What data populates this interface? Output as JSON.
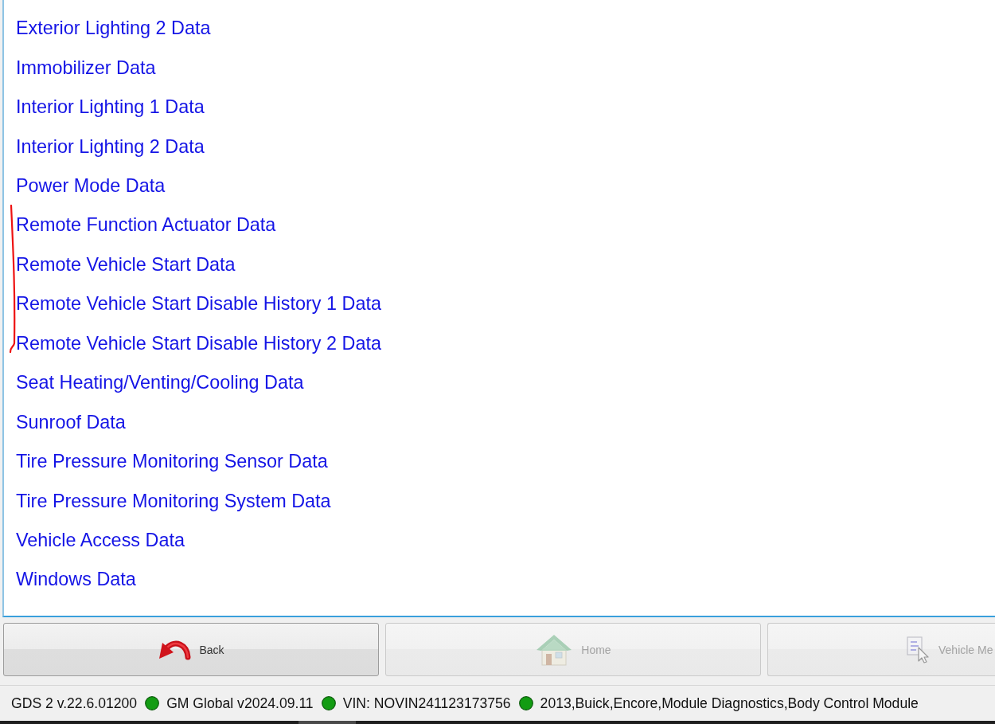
{
  "data_list": {
    "items": [
      {
        "label": "Exterior Lighting 2 Data",
        "marked": false
      },
      {
        "label": "Immobilizer Data",
        "marked": false
      },
      {
        "label": "Interior Lighting 1 Data",
        "marked": false
      },
      {
        "label": "Interior Lighting 2 Data",
        "marked": false
      },
      {
        "label": "Power Mode Data",
        "marked": false
      },
      {
        "label": "Remote Function Actuator Data",
        "marked": true
      },
      {
        "label": "Remote Vehicle Start Data",
        "marked": true
      },
      {
        "label": "Remote Vehicle Start Disable History 1 Data",
        "marked": true
      },
      {
        "label": "Remote Vehicle Start Disable History 2 Data",
        "marked": true
      },
      {
        "label": "Seat Heating/Venting/Cooling Data",
        "marked": false
      },
      {
        "label": "Sunroof Data",
        "marked": false
      },
      {
        "label": "Tire Pressure Monitoring Sensor Data",
        "marked": false
      },
      {
        "label": "Tire Pressure Monitoring System Data",
        "marked": false
      },
      {
        "label": "Vehicle Access Data",
        "marked": false
      },
      {
        "label": "Windows Data",
        "marked": false
      }
    ]
  },
  "buttons": [
    {
      "label": "Back",
      "kind": "back",
      "disabled": false
    },
    {
      "label": "Home",
      "kind": "home",
      "disabled": true
    },
    {
      "label": "Vehicle Me",
      "kind": "menu",
      "disabled": true
    }
  ],
  "status_bar": {
    "version": "GDS 2 v.22.6.01200",
    "items": [
      {
        "text": "GM Global v2024.09.11",
        "color": "#139c13"
      },
      {
        "text": "VIN: NOVIN241123173756",
        "color": "#139c13"
      },
      {
        "text": "2013,Buick,Encore,Module Diagnostics,Body Control Module",
        "color": "#139c13"
      }
    ]
  }
}
